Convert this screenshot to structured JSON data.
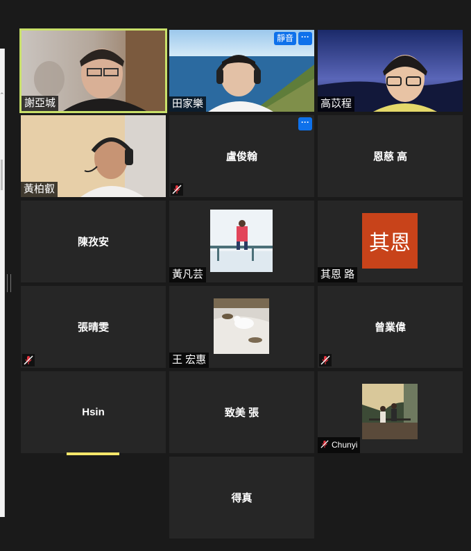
{
  "meeting": {
    "tiles": [
      {
        "name": "謝亞城",
        "type": "video"
      },
      {
        "name": "田家樂",
        "type": "video",
        "badge": "靜音",
        "more": "···"
      },
      {
        "name": "高苡程",
        "type": "video"
      },
      {
        "name": "黃柏叡",
        "type": "video"
      },
      {
        "name": "盧俊翰",
        "type": "name",
        "more": "···",
        "muted": true
      },
      {
        "name": "恩慈 高",
        "type": "name"
      },
      {
        "name": "陳孜安",
        "type": "name"
      },
      {
        "name": "黃凡芸",
        "type": "avatar"
      },
      {
        "name": "其恩 路",
        "type": "avatar",
        "avatar_text": "其恩",
        "avatar_color": "#c8431a"
      },
      {
        "name": "張晴雯",
        "type": "name",
        "muted": true
      },
      {
        "name": "王 宏惠",
        "type": "avatar"
      },
      {
        "name": "曾業偉",
        "type": "name",
        "muted": true
      },
      {
        "name": "Hsin",
        "type": "name",
        "speaking": true
      },
      {
        "name": "致美 張",
        "type": "name"
      },
      {
        "name": "Chunyi",
        "type": "avatar",
        "muted": true
      },
      {
        "name": "得真",
        "type": "name"
      }
    ],
    "colors": {
      "active_border": "#c9e06a",
      "tile_bg": "#262626",
      "accent": "#0e71eb",
      "muted_red": "#e0343f",
      "speaking_bar": "#f5e66a"
    }
  }
}
